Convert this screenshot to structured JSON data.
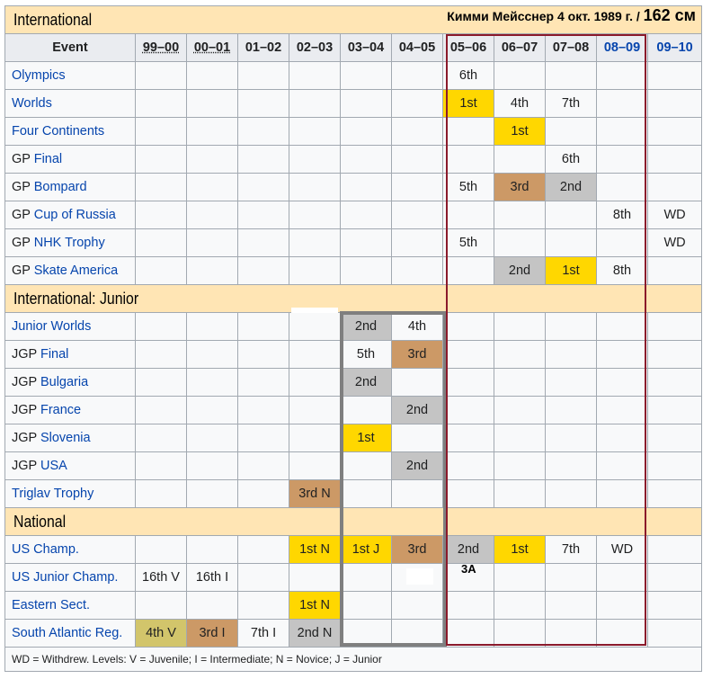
{
  "sections": {
    "international": "International",
    "junior": "International: Junior",
    "national": "National"
  },
  "overlay": {
    "caption": "Кимми Мейсснер 4 окт. 1989 г. /",
    "height": "162 см",
    "tag": "3A"
  },
  "header": {
    "event": "Event",
    "seasons": [
      "99–00",
      "00–01",
      "01–02",
      "02–03",
      "03–04",
      "04–05",
      "05–06",
      "06–07",
      "07–08",
      "08–09",
      "09–10"
    ]
  },
  "international_rows": [
    {
      "prefix": "",
      "name": "Olympics",
      "results": [
        "",
        "",
        "",
        "",
        "",
        "",
        "6th",
        "",
        "",
        "",
        ""
      ]
    },
    {
      "prefix": "",
      "name": "Worlds",
      "results": [
        "",
        "",
        "",
        "",
        "",
        "",
        "1st",
        "4th",
        "7th",
        "",
        ""
      ]
    },
    {
      "prefix": "",
      "name": "Four Continents",
      "results": [
        "",
        "",
        "",
        "",
        "",
        "",
        "",
        "1st",
        "",
        "",
        ""
      ]
    },
    {
      "prefix": "GP ",
      "name": "Final",
      "results": [
        "",
        "",
        "",
        "",
        "",
        "",
        "",
        "",
        "6th",
        "",
        ""
      ]
    },
    {
      "prefix": "GP ",
      "name": "Bompard",
      "results": [
        "",
        "",
        "",
        "",
        "",
        "",
        "5th",
        "3rd",
        "2nd",
        "",
        ""
      ]
    },
    {
      "prefix": "GP ",
      "name": "Cup of Russia",
      "results": [
        "",
        "",
        "",
        "",
        "",
        "",
        "",
        "",
        "",
        "8th",
        "WD"
      ]
    },
    {
      "prefix": "GP ",
      "name": "NHK Trophy",
      "results": [
        "",
        "",
        "",
        "",
        "",
        "",
        "5th",
        "",
        "",
        "",
        "WD"
      ]
    },
    {
      "prefix": "GP ",
      "name": "Skate America",
      "results": [
        "",
        "",
        "",
        "",
        "",
        "",
        "",
        "2nd",
        "1st",
        "8th",
        ""
      ]
    }
  ],
  "junior_rows": [
    {
      "prefix": "",
      "name": "Junior Worlds",
      "results": [
        "",
        "",
        "",
        "",
        "2nd",
        "4th",
        "",
        "",
        "",
        "",
        ""
      ]
    },
    {
      "prefix": "JGP ",
      "name": "Final",
      "results": [
        "",
        "",
        "",
        "",
        "5th",
        "3rd",
        "",
        "",
        "",
        "",
        ""
      ]
    },
    {
      "prefix": "JGP ",
      "name": "Bulgaria",
      "results": [
        "",
        "",
        "",
        "",
        "2nd",
        "",
        "",
        "",
        "",
        "",
        ""
      ]
    },
    {
      "prefix": "JGP ",
      "name": "France",
      "results": [
        "",
        "",
        "",
        "",
        "",
        "2nd",
        "",
        "",
        "",
        "",
        ""
      ]
    },
    {
      "prefix": "JGP ",
      "name": "Slovenia",
      "results": [
        "",
        "",
        "",
        "",
        "1st",
        "",
        "",
        "",
        "",
        "",
        ""
      ]
    },
    {
      "prefix": "JGP ",
      "name": "USA",
      "results": [
        "",
        "",
        "",
        "",
        "",
        "2nd",
        "",
        "",
        "",
        "",
        ""
      ]
    },
    {
      "prefix": "",
      "name": "Triglav Trophy",
      "results": [
        "",
        "",
        "",
        "3rd N",
        "",
        "",
        "",
        "",
        "",
        "",
        ""
      ]
    }
  ],
  "national_rows": [
    {
      "prefix": "",
      "name": "US Champ.",
      "results": [
        "",
        "",
        "",
        "1st N",
        "1st J",
        "3rd",
        "2nd",
        "1st",
        "7th",
        "WD",
        ""
      ]
    },
    {
      "prefix": "",
      "name": "US Junior Champ.",
      "results": [
        "16th V",
        "16th I",
        "",
        "",
        "",
        "",
        "",
        "",
        "",
        "",
        ""
      ]
    },
    {
      "prefix": "",
      "name": "Eastern Sect.",
      "results": [
        "",
        "",
        "",
        "1st N",
        "",
        "",
        "",
        "",
        "",
        "",
        ""
      ]
    },
    {
      "prefix": "",
      "name": "South Atlantic Reg.",
      "results": [
        "4th V",
        "3rd I",
        "7th I",
        "2nd N",
        "",
        "",
        "",
        "",
        "",
        "",
        ""
      ]
    }
  ],
  "legend": "WD = Withdrew. Levels: V = Juvenile; I = Intermediate; N = Novice; J = Junior",
  "colors": {
    "gold": "#ffd700",
    "silver": "#c4c4c4",
    "bronze": "#cc9966",
    "olive": "#d2c56b",
    "section_bg": "#ffe5b4",
    "red_box": "#8b1a2b",
    "gray_box": "#7f7f7f"
  }
}
